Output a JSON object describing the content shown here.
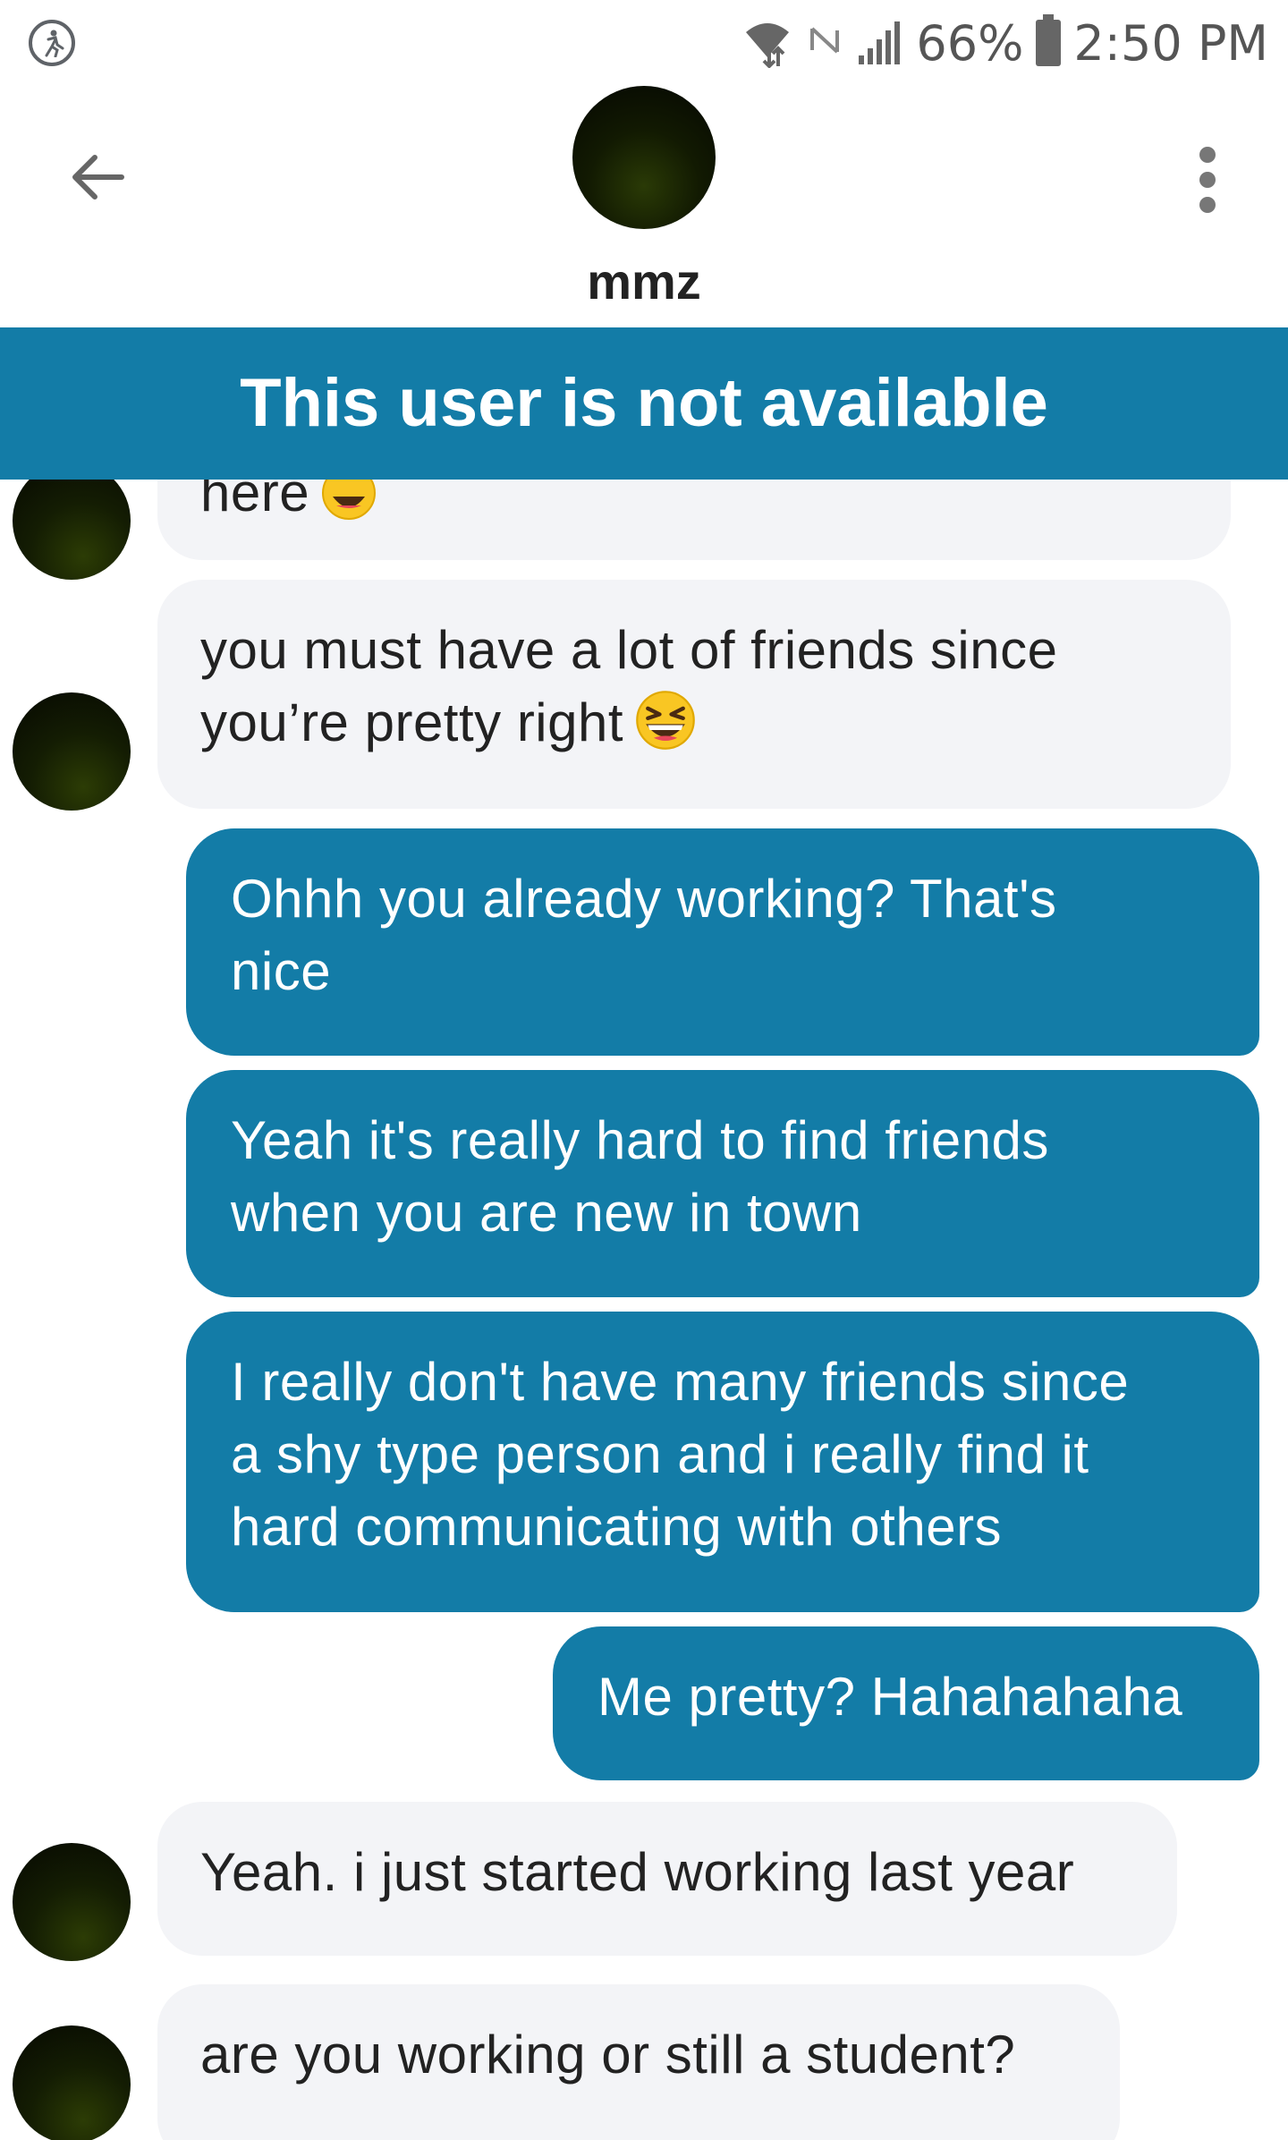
{
  "status_bar": {
    "battery_percent": "66%",
    "time": "2:50 PM",
    "icons": [
      "accessibility-icon",
      "wifi-icon",
      "no-signal-icon",
      "signal-bars-icon",
      "battery-icon"
    ]
  },
  "header": {
    "name": "mmz",
    "back_icon": "arrow-left-icon",
    "more_icon": "more-vertical-icon"
  },
  "banner": {
    "text": "This user is not available"
  },
  "messages": [
    {
      "from": "them",
      "text": "here",
      "emoji": "grinning-squinting-face",
      "partially_hidden": true
    },
    {
      "from": "them",
      "lines": [
        "you must have a lot of friends since",
        "you’re pretty right"
      ],
      "emoji": "grinning-squinting-face"
    },
    {
      "from": "me",
      "lines": [
        "Ohhh you already working? That's",
        "nice"
      ]
    },
    {
      "from": "me",
      "lines": [
        "Yeah it's really hard to find friends",
        "when you are new in town"
      ]
    },
    {
      "from": "me",
      "lines": [
        "I really don't have many friends since",
        "a shy type person and i really find it",
        "hard communicating with others"
      ]
    },
    {
      "from": "me",
      "lines": [
        "Me pretty? Hahahahaha"
      ]
    },
    {
      "from": "them",
      "lines": [
        "Yeah. i just started working last year"
      ]
    },
    {
      "from": "them",
      "lines": [
        "are you working or still a student?"
      ]
    }
  ],
  "colors": {
    "accent": "#137ca7",
    "incoming_bubble": "#f3f4f7",
    "text": "#222222"
  }
}
